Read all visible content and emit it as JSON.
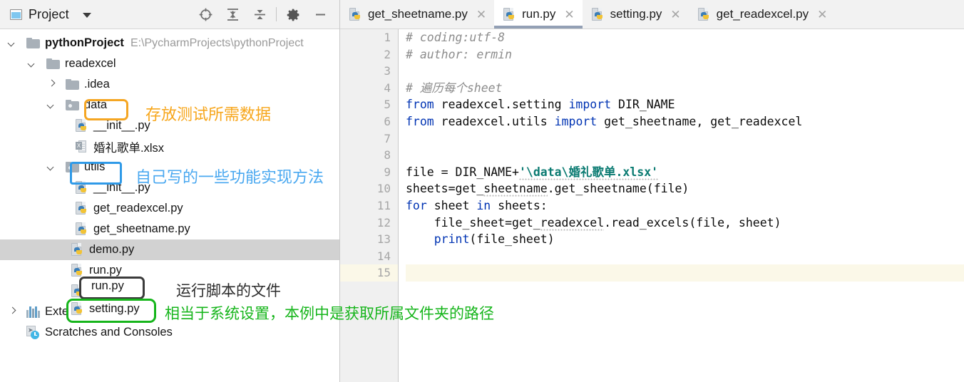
{
  "project_pane": {
    "title": "Project",
    "window_icon": "project-window-icon",
    "dropdown_icon": "chevron-down-icon",
    "toolbar": [
      {
        "name": "scroll-from-source-icon",
        "label": "locate"
      },
      {
        "name": "expand-all-icon",
        "label": "expand all"
      },
      {
        "name": "collapse-all-icon",
        "label": "collapse all"
      },
      {
        "name": "gear-icon",
        "label": "settings"
      },
      {
        "name": "minimize-icon",
        "label": "hide"
      }
    ],
    "tree": [
      {
        "label": "pythonProject",
        "path": "E:\\PycharmProjects\\pythonProject",
        "icon": "folder-icon",
        "indent": 0,
        "twisty": "down",
        "bold": true
      },
      {
        "label": "readexcel",
        "icon": "folder-icon",
        "indent": 1,
        "twisty": "down"
      },
      {
        "label": ".idea",
        "icon": "folder-icon",
        "indent": 2,
        "twisty": "right"
      },
      {
        "label": "data",
        "icon": "source-folder-icon",
        "indent": 2,
        "twisty": "down",
        "box": "orange"
      },
      {
        "label": "__init__.py",
        "icon": "python-file-icon",
        "indent": 3,
        "twisty": "none"
      },
      {
        "label": "婚礼歌单.xlsx",
        "icon": "excel-file-icon",
        "indent": 3,
        "twisty": "none"
      },
      {
        "label": "utils",
        "icon": "source-folder-icon",
        "indent": 2,
        "twisty": "down",
        "box": "blue"
      },
      {
        "label": "__init__.py",
        "icon": "python-file-icon",
        "indent": 3,
        "twisty": "none"
      },
      {
        "label": "get_readexcel.py",
        "icon": "python-file-icon",
        "indent": 3,
        "twisty": "none"
      },
      {
        "label": "get_sheetname.py",
        "icon": "python-file-icon",
        "indent": 3,
        "twisty": "none"
      },
      {
        "label": "demo.py",
        "icon": "python-file-icon",
        "indent": 2,
        "twisty": "none",
        "selected": true
      },
      {
        "label": "run.py",
        "icon": "python-file-icon",
        "indent": 2,
        "twisty": "none",
        "box": "dark"
      },
      {
        "label": "setting.py",
        "icon": "python-file-icon",
        "indent": 2,
        "twisty": "none",
        "box": "green"
      },
      {
        "label": "External Libraries",
        "icon": "external-libraries-icon",
        "indent": 0,
        "twisty": "right"
      },
      {
        "label": "Scratches and Consoles",
        "icon": "scratches-icon",
        "indent": 0,
        "twisty": "none"
      }
    ],
    "annotations": [
      {
        "text": "存放测试所需数据",
        "color": "#f7a61b",
        "target": "data"
      },
      {
        "text": "自己写的一些功能实现方法",
        "color": "#4aa8f0",
        "target": "utils"
      },
      {
        "text": "运行脚本的文件",
        "color": "#2b2b2b",
        "target": "run.py"
      },
      {
        "text": "相当于系统设置，本例中是获取所属文件夹的路径",
        "color": "#16b51b",
        "target": "setting.py"
      }
    ]
  },
  "editor": {
    "tabs": [
      {
        "label": "get_sheetname.py",
        "icon": "python-file-icon",
        "active": false,
        "close_icon": "close-icon"
      },
      {
        "label": "run.py",
        "icon": "python-file-icon",
        "active": true,
        "close_icon": "close-icon"
      },
      {
        "label": "setting.py",
        "icon": "python-file-icon",
        "active": false,
        "close_icon": "close-icon"
      },
      {
        "label": "get_readexcel.py",
        "icon": "python-file-icon",
        "active": false,
        "close_icon": "close-icon"
      }
    ],
    "line_numbers": [
      "1",
      "2",
      "3",
      "4",
      "5",
      "6",
      "7",
      "8",
      "9",
      "10",
      "11",
      "12",
      "13",
      "14",
      "15"
    ],
    "current_line": 15,
    "code_lines": [
      {
        "n": 1,
        "text": "# coding:utf-8",
        "fold": "open"
      },
      {
        "n": 2,
        "text": "# author: ermin",
        "fold": ""
      },
      {
        "n": 3,
        "text": "",
        "fold": ""
      },
      {
        "n": 4,
        "text": "# 遍历每个sheet",
        "fold": "end"
      },
      {
        "n": 5,
        "text": "from readexcel.setting import DIR_NAME",
        "fold": "open"
      },
      {
        "n": 6,
        "text": "from readexcel.utils import get_sheetname, get_readexcel",
        "fold": "end"
      },
      {
        "n": 7,
        "text": "",
        "fold": ""
      },
      {
        "n": 8,
        "text": "",
        "fold": ""
      },
      {
        "n": 9,
        "text": "file = DIR_NAME+'\\data\\婚礼歌单.xlsx'",
        "fold": ""
      },
      {
        "n": 10,
        "text": "sheets=get_sheetname.get_sheetname(file)",
        "fold": ""
      },
      {
        "n": 11,
        "text": "for sheet in sheets:",
        "fold": "open"
      },
      {
        "n": 12,
        "text": "    file_sheet=get_readexcel.read_excels(file, sheet)",
        "fold": ""
      },
      {
        "n": 13,
        "text": "    print(file_sheet)",
        "fold": "endb"
      },
      {
        "n": 14,
        "text": "",
        "fold": ""
      },
      {
        "n": 15,
        "text": "",
        "fold": ""
      }
    ]
  },
  "colors": {
    "keyword": "#0033b3",
    "string": "#0b7b72",
    "comment": "#8c8c8c",
    "selection": "#d2d2d2",
    "current_line": "#fbf8e8",
    "tab_active_underline": "#93a0b5"
  }
}
